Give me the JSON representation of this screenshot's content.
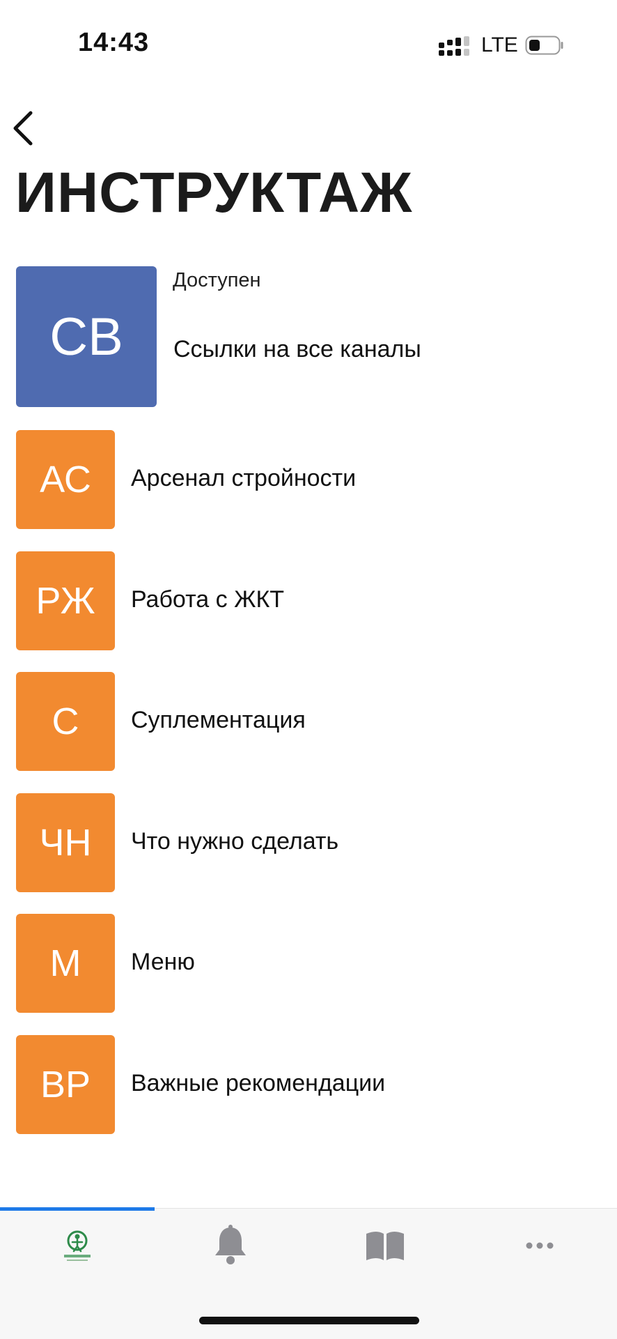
{
  "status_bar": {
    "time": "14:43",
    "network": "LTE"
  },
  "header": {
    "title": "ИНСТРУКТАЖ"
  },
  "items": [
    {
      "initials": "СВ",
      "label": "Ссылки на все каналы",
      "status": "Доступен",
      "color": "#4f6bb0"
    },
    {
      "initials": "АС",
      "label": "Арсенал стройности",
      "color": "#f28a30"
    },
    {
      "initials": "РЖ",
      "label": "Работа с ЖКТ",
      "color": "#f28a30"
    },
    {
      "initials": "С",
      "label": "Суплементация",
      "color": "#f28a30"
    },
    {
      "initials": "ЧН",
      "label": "Что нужно сделать",
      "color": "#f28a30"
    },
    {
      "initials": "М",
      "label": "Меню",
      "color": "#f28a30"
    },
    {
      "initials": "ВР",
      "label": "Важные рекомендации",
      "color": "#f28a30"
    }
  ],
  "tabbar": {
    "tabs": [
      {
        "icon": "app-logo-icon",
        "active": true
      },
      {
        "icon": "bell-icon",
        "active": false
      },
      {
        "icon": "book-icon",
        "active": false
      },
      {
        "icon": "more-icon",
        "active": false
      }
    ],
    "accent": "#1e7ae8"
  }
}
